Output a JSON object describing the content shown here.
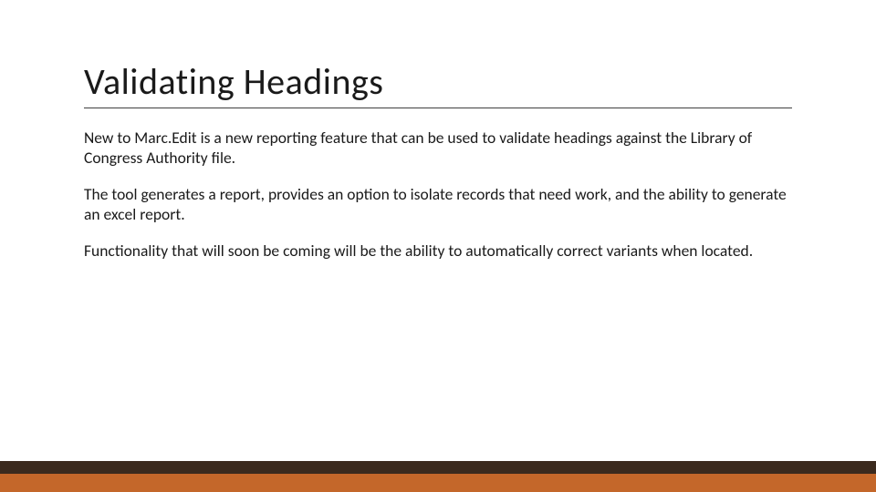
{
  "slide": {
    "title": "Validating Headings",
    "paragraphs": [
      "New to Marc.Edit is a new reporting feature that can be used to validate headings against the Library of Congress Authority file.",
      "The tool generates a report, provides an option to isolate records that need work, and the ability to generate an excel report.",
      "Functionality that will soon be coming will be the ability to automatically correct variants when located."
    ]
  },
  "colors": {
    "band_dark": "#3b2a1e",
    "band_orange": "#c4672a"
  }
}
